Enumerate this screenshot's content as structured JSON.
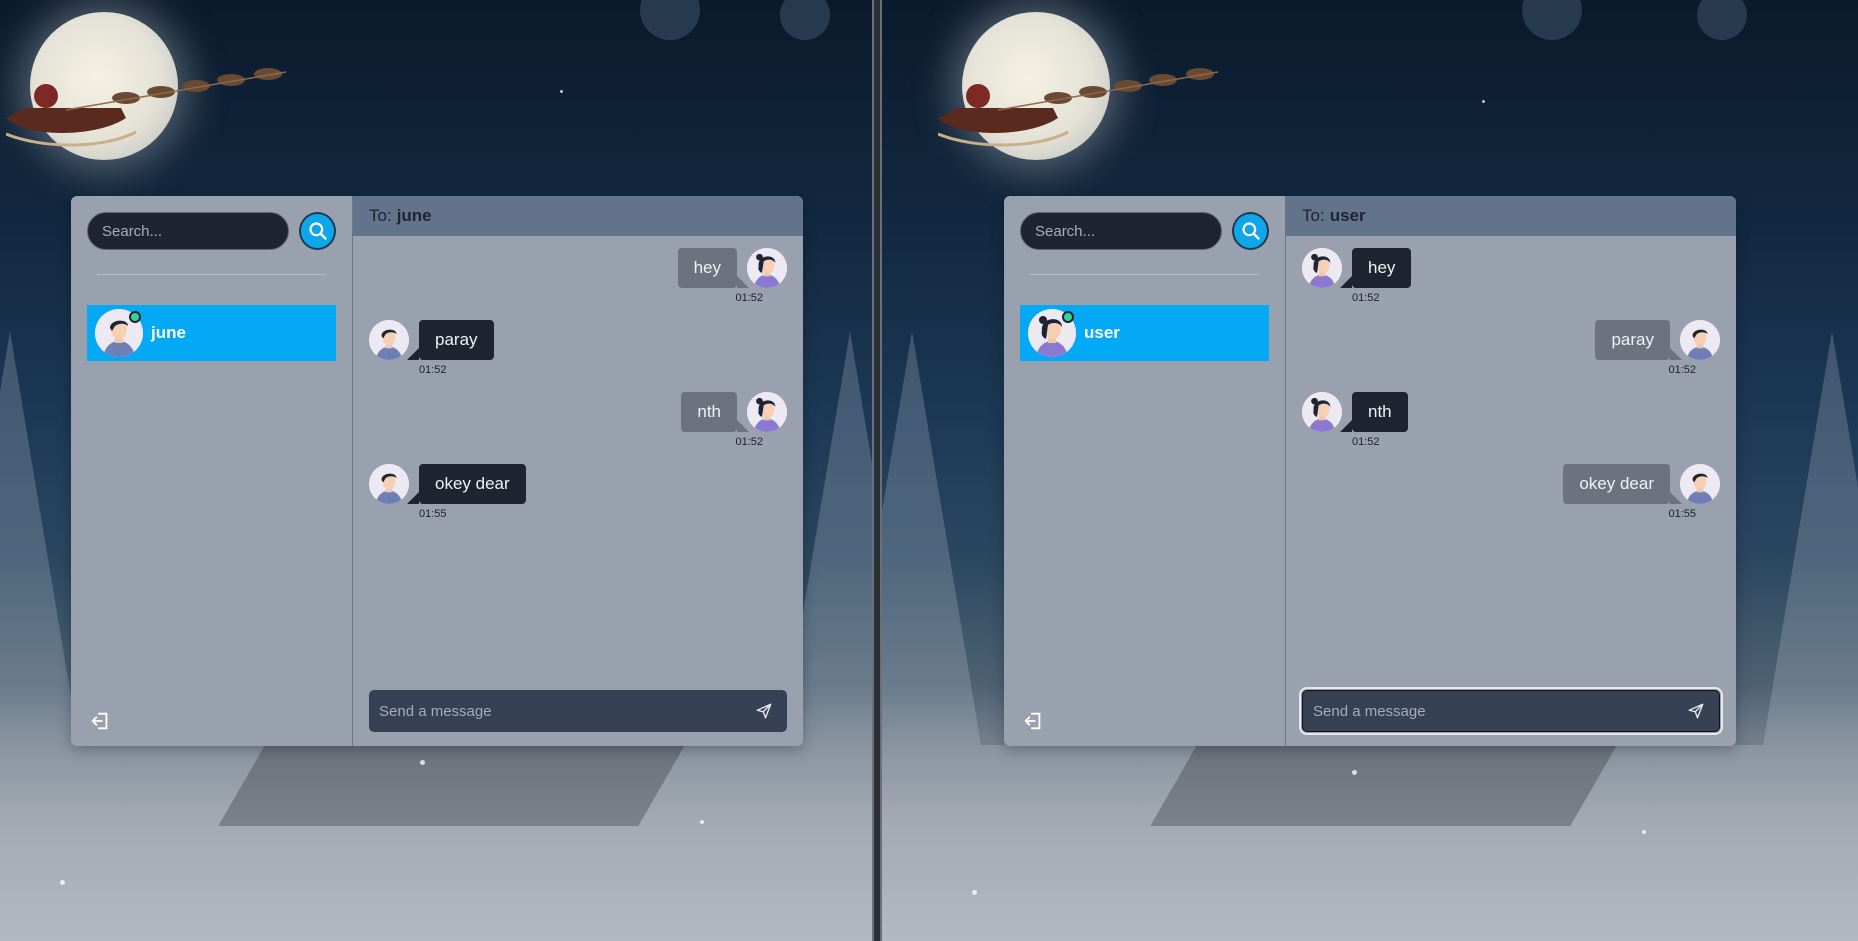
{
  "left": {
    "search": {
      "placeholder": "Search..."
    },
    "contact": {
      "name": "june",
      "online": true
    },
    "header": {
      "prefix": "To:",
      "recipient": "june"
    },
    "messages": [
      {
        "text": "hey",
        "time": "01:52",
        "direction": "out"
      },
      {
        "text": "paray",
        "time": "01:52",
        "direction": "in"
      },
      {
        "text": "nth",
        "time": "01:52",
        "direction": "out"
      },
      {
        "text": "okey dear",
        "time": "01:55",
        "direction": "in"
      }
    ],
    "composer": {
      "placeholder": "Send a message"
    }
  },
  "right": {
    "search": {
      "placeholder": "Search..."
    },
    "contact": {
      "name": "user",
      "online": true
    },
    "header": {
      "prefix": "To:",
      "recipient": "user"
    },
    "messages": [
      {
        "text": "hey",
        "time": "01:52",
        "direction": "in"
      },
      {
        "text": "paray",
        "time": "01:52",
        "direction": "out"
      },
      {
        "text": "nth",
        "time": "01:52",
        "direction": "in"
      },
      {
        "text": "okey dear",
        "time": "01:55",
        "direction": "out"
      }
    ],
    "composer": {
      "placeholder": "Send a message"
    }
  },
  "colors": {
    "accent": "#03a9f4",
    "search_button": "#0ea5e9",
    "header": "#64738c",
    "panel": "#9aa1ae",
    "bubble_dark": "#1f2530",
    "bubble_light": "#6c737f",
    "online": "#36d399"
  },
  "icons": {
    "search": "search-icon",
    "logout": "logout-icon",
    "send": "send-icon"
  }
}
